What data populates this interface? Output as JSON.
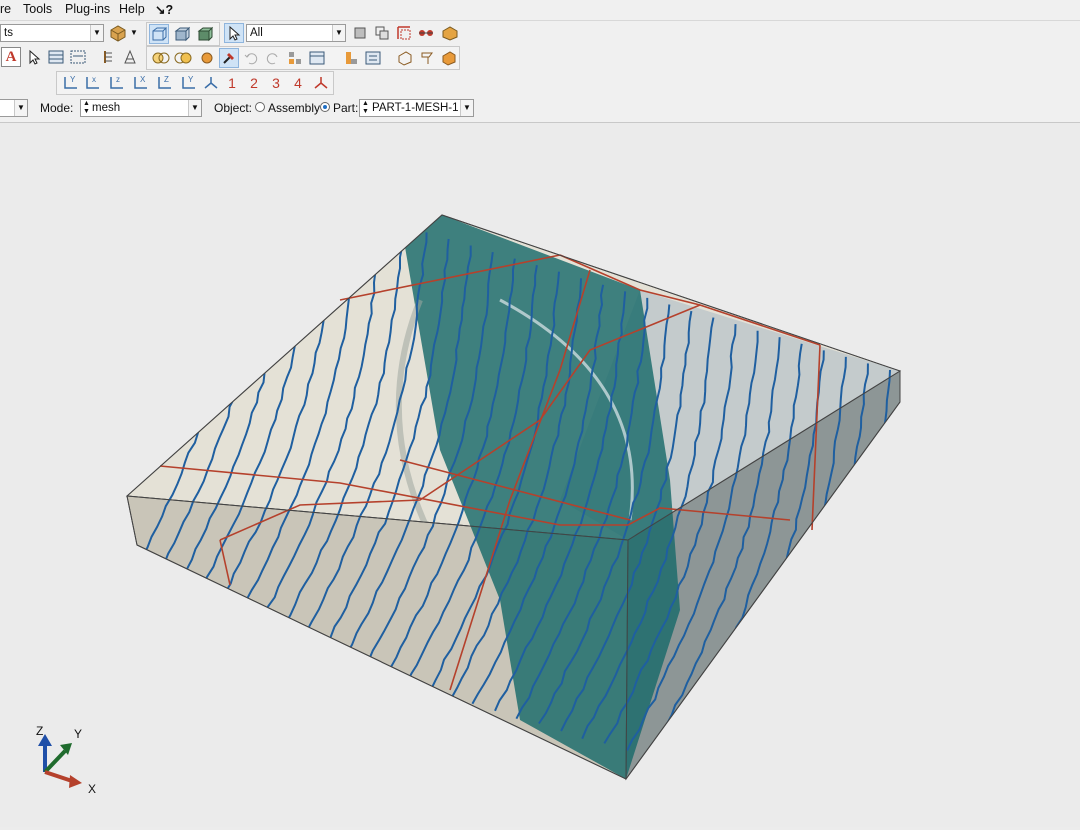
{
  "menubar": {
    "items": [
      {
        "label": "re"
      },
      {
        "label": "Tools"
      },
      {
        "label": "Plug-ins"
      },
      {
        "label": "Help"
      },
      {
        "label": "↘?"
      }
    ]
  },
  "toolbar": {
    "filter_combo": "ts",
    "selection_filter": "All",
    "text_tool": "A",
    "view_numbers": [
      "1",
      "2",
      "3",
      "4"
    ]
  },
  "context": {
    "mode_label": "Mode:",
    "mode_value": "mesh",
    "object_label": "Object:",
    "assembly_label": "Assembly",
    "part_label": "Part:",
    "part_value": "PART-1-MESH-1",
    "part_selected": true
  },
  "triad": {
    "x_label": "X",
    "y_label": "Y",
    "z_label": "Z"
  },
  "colors": {
    "mesh_lines": "#1f5fa0",
    "partition_lines": "#b5412c",
    "body_top": "#e4e1d6",
    "transparent_overlay": "#1a6a6a",
    "background": "#ebebeb"
  }
}
